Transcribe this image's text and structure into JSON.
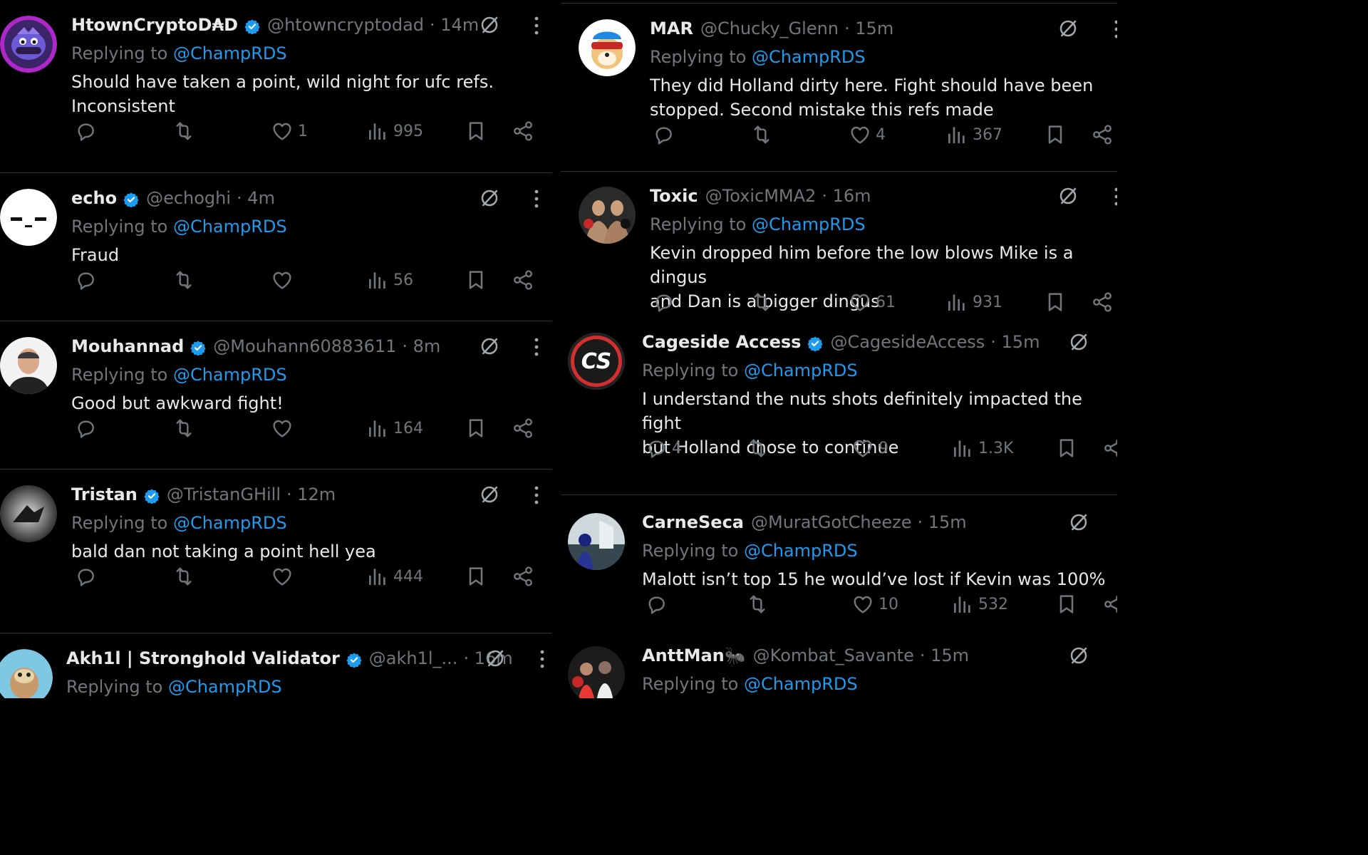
{
  "replying_label": "Replying to",
  "reply_target": "@ChampRDS",
  "colors": {
    "background": "#000000",
    "text": "#e7e9ea",
    "muted": "#71767b",
    "accent": "#1d9bf0",
    "divider": "#2f3336"
  },
  "icons": [
    "reply-icon",
    "retweet-icon",
    "like-icon",
    "views-icon",
    "bookmark-icon",
    "share-icon",
    "grok-icon",
    "more-icon",
    "verified-badge-icon"
  ],
  "left_column": [
    {
      "name": "HtownCryptoD₳D",
      "verified": true,
      "handle": "@htowncryptodad",
      "time": "· 14m",
      "text_lines": [
        "Should have taken a point, wild night for ufc refs.",
        "Inconsistent"
      ],
      "replies": "",
      "retweets": "",
      "likes": "1",
      "views": "995"
    },
    {
      "name": "echo",
      "verified": true,
      "handle": "@echoghi",
      "time": "· 4m",
      "text_lines": [
        "Fraud"
      ],
      "replies": "",
      "retweets": "",
      "likes": "",
      "views": "56"
    },
    {
      "name": "Mouhannad",
      "verified": true,
      "handle": "@Mouhann60883611",
      "time": "· 8m",
      "text_lines": [
        "Good but awkward fight!"
      ],
      "replies": "",
      "retweets": "",
      "likes": "",
      "views": "164"
    },
    {
      "name": "Tristan",
      "verified": true,
      "handle": "@TristanGHill",
      "time": "· 12m",
      "text_lines": [
        "bald dan not taking a point hell yea"
      ],
      "replies": "",
      "retweets": "",
      "likes": "",
      "views": "444"
    },
    {
      "name": "Akh1l | Stronghold Validator",
      "verified": true,
      "handle": "@akh1l_...",
      "time": "· 16m",
      "text_lines": [],
      "replies": "",
      "retweets": "",
      "likes": "",
      "views": ""
    }
  ],
  "right_column": [
    {
      "name": "MAR",
      "verified": false,
      "handle": "@Chucky_Glenn",
      "time": "· 15m",
      "text_lines": [
        "They did Holland dirty here. Fight should have been",
        "stopped. Second mistake this refs made"
      ],
      "replies": "",
      "retweets": "",
      "likes": "4",
      "views": "367"
    },
    {
      "name": "Toxic",
      "verified": false,
      "handle": "@ToxicMMA2",
      "time": "· 16m",
      "text_lines": [
        "Kevin dropped him before the low blows Mike is a dingus",
        "and Dan is a bigger dingus"
      ],
      "replies": "",
      "retweets": "",
      "likes": "61",
      "views": "931"
    },
    {
      "name": "Cageside Access",
      "verified": true,
      "handle": "@CagesideAccess",
      "time": "· 15m",
      "avatar_text": "CS",
      "text_lines": [
        "I understand the nuts shots definitely impacted the fight",
        "but Holland chose to continue"
      ],
      "replies": "4",
      "retweets": "",
      "likes": "9",
      "views": "1.3K"
    },
    {
      "name": "CarneSeca",
      "verified": false,
      "handle": "@MuratGotCheeze",
      "time": "· 15m",
      "text_lines": [
        "Malott isn’t top 15 he would’ve lost if Kevin was 100%"
      ],
      "replies": "",
      "retweets": "",
      "likes": "10",
      "views": "532"
    },
    {
      "name": "AnttMan🐜",
      "verified": false,
      "handle": "@Kombat_Savante",
      "time": "· 15m",
      "text_lines": [],
      "replies": "",
      "retweets": "",
      "likes": "",
      "views": ""
    }
  ]
}
